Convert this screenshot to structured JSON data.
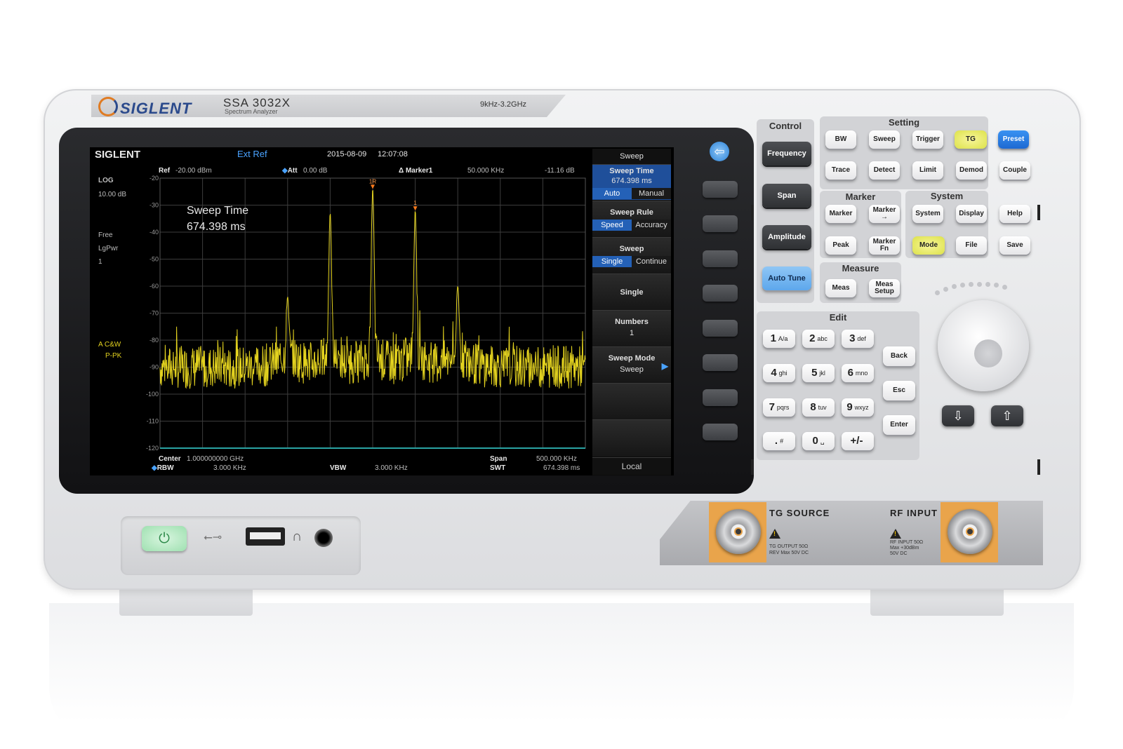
{
  "device": {
    "brand": "SIGLENT",
    "model": "SSA 3032X",
    "model_subtitle": "Spectrum Analyzer",
    "freq_range": "9kHz-3.2GHz"
  },
  "screen": {
    "brand": "SIGLENT",
    "ext_ref": "Ext Ref",
    "date": "2015-08-09",
    "time": "12:07:08",
    "ref_label": "Ref",
    "ref_value": "-20.00 dBm",
    "att_label": "Att",
    "att_value": "0.00 dB",
    "marker_label": "Δ Marker1",
    "marker_freq": "50.000  KHz",
    "marker_level": "-11.16 dB",
    "left_info": [
      "LOG",
      "10.00 dB",
      "Free",
      "LgPwr",
      "1"
    ],
    "trace_info": [
      "A  C&W",
      "P-PK"
    ],
    "overlay_title": "Sweep Time",
    "overlay_value": "674.398 ms",
    "center_label": "Center",
    "center_value": "1.000000000  GHz",
    "span_label": "Span",
    "span_value": "500.000  KHz",
    "rbw_label": "RBW",
    "rbw_value": "3.000  KHz",
    "vbw_label": "VBW",
    "vbw_value": "3.000  KHz",
    "swt_label": "SWT",
    "swt_value": "674.398 ms",
    "marker_tags": [
      "1R",
      "1"
    ]
  },
  "menu": {
    "title": "Sweep",
    "sweep_time_label": "Sweep Time",
    "sweep_time_value": "674.398 ms",
    "sweep_time_opts": [
      "Auto",
      "Manual"
    ],
    "sweep_rule_label": "Sweep Rule",
    "sweep_rule_opts": [
      "Speed",
      "Accuracy"
    ],
    "sweep_label": "Sweep",
    "sweep_opts": [
      "Single",
      "Continue"
    ],
    "single_label": "Single",
    "numbers_label": "Numbers",
    "numbers_value": "1",
    "sweep_mode_label": "Sweep Mode",
    "sweep_mode_value": "Sweep",
    "local_label": "Local"
  },
  "panels": {
    "control": "Control",
    "setting": "Setting",
    "marker": "Marker",
    "system": "System",
    "measure": "Measure",
    "edit": "Edit"
  },
  "keys": {
    "frequency": "Frequency",
    "span": "Span",
    "amplitude": "Amplitude",
    "auto_tune": "Auto Tune",
    "bw": "BW",
    "sweep": "Sweep",
    "trigger": "Trigger",
    "tg": "TG",
    "preset": "Preset",
    "trace": "Trace",
    "detect": "Detect",
    "limit": "Limit",
    "demod": "Demod",
    "couple": "Couple",
    "marker": "Marker",
    "marker_to": "Marker",
    "marker_to_arrow": "→",
    "system": "System",
    "display": "Display",
    "help": "Help",
    "peak": "Peak",
    "marker_fn_1": "Marker",
    "marker_fn_2": "Fn",
    "mode": "Mode",
    "file": "File",
    "save": "Save",
    "meas": "Meas",
    "meas_setup_1": "Meas",
    "meas_setup_2": "Setup",
    "back": "Back",
    "esc": "Esc",
    "enter": "Enter",
    "down_arrow": "⇩",
    "up_arrow": "⇧",
    "numpad": [
      {
        "big": "1",
        "small": "A/a"
      },
      {
        "big": "2",
        "small": "abc"
      },
      {
        "big": "3",
        "small": "def"
      },
      {
        "big": "4",
        "small": "ghi"
      },
      {
        "big": "5",
        "small": "jkl"
      },
      {
        "big": "6",
        "small": "mno"
      },
      {
        "big": "7",
        "small": "pqrs"
      },
      {
        "big": "8",
        "small": "tuv"
      },
      {
        "big": "9",
        "small": "wxyz"
      },
      {
        "big": ".",
        "small": "#"
      },
      {
        "big": "0",
        "small": "␣"
      },
      {
        "big": "+/-",
        "small": ""
      }
    ]
  },
  "io": {
    "tg_source": "TG SOURCE",
    "tg_small_1": "TG OUTPUT 50Ω",
    "tg_small_2": "REV Max 50V DC",
    "rf_input": "RF INPUT",
    "rf_small_1": "RF INPUT 50Ω",
    "rf_small_2": "Max +30dBm",
    "rf_small_3": "50V DC"
  },
  "colors": {
    "trace": "#e3d21f",
    "accent_blue": "#2461b7",
    "panel": "#d2d3d6",
    "grid": "#3c3c3c"
  },
  "chart_data": {
    "type": "line",
    "ylim": [
      -120,
      -20
    ],
    "yticks": [
      -20,
      -30,
      -40,
      -50,
      -60,
      -70,
      -80,
      -90,
      -100,
      -110,
      -120
    ],
    "x_divisions": 10,
    "noise_floor": -90,
    "peaks": [
      {
        "x_div": 3.0,
        "level": -64
      },
      {
        "x_div": 4.0,
        "level": -33
      },
      {
        "x_div": 5.0,
        "level": -24
      },
      {
        "x_div": 6.0,
        "level": -32
      },
      {
        "x_div": 7.0,
        "level": -60
      }
    ]
  }
}
